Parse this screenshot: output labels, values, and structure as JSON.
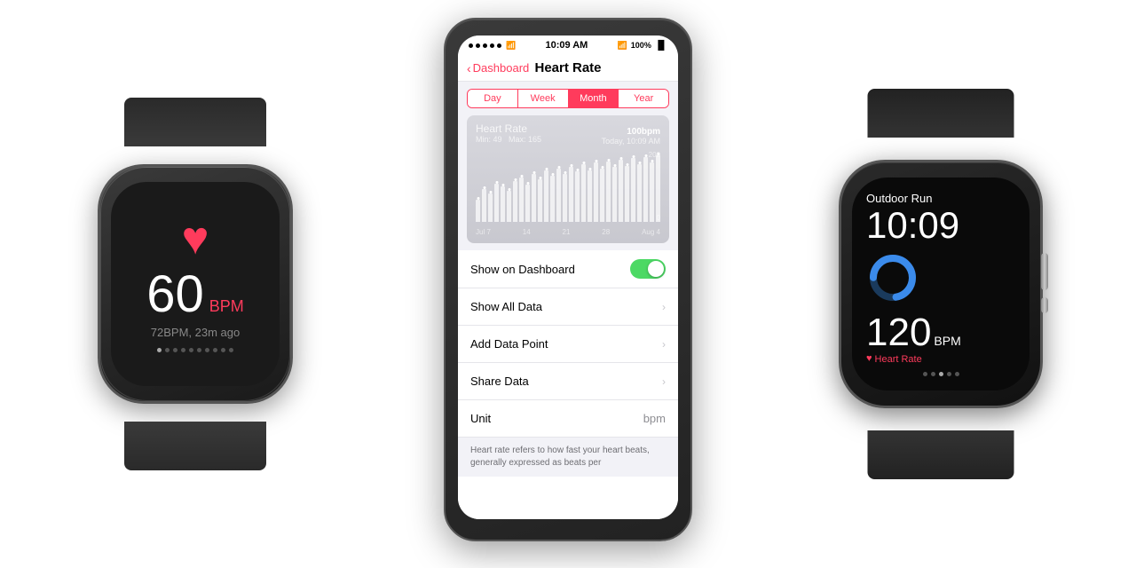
{
  "scene": {
    "background": "#ffffff"
  },
  "watch_left": {
    "heart_icon": "♥",
    "bpm_number": "60",
    "bpm_label": "BPM",
    "sub_text": "72BPM, 23m ago",
    "dots_count": 10,
    "active_dot": 0
  },
  "iphone": {
    "status_bar": {
      "dots": 5,
      "time": "10:09 AM",
      "battery": "100%"
    },
    "nav": {
      "back_label": "Dashboard",
      "title": "Heart Rate"
    },
    "period_tabs": [
      {
        "label": "Day",
        "active": false
      },
      {
        "label": "Week",
        "active": false
      },
      {
        "label": "Month",
        "active": true
      },
      {
        "label": "Year",
        "active": false
      }
    ],
    "chart": {
      "title": "Heart Rate",
      "min_label": "Min: 49",
      "max_label": "Max: 165",
      "current_bpm": "100",
      "bpm_unit": "bpm",
      "date_label": "Today, 10:09 AM",
      "y_max": "200",
      "y_min": "0",
      "x_labels": [
        "Jul 7",
        "14",
        "21",
        "28",
        "Aug 4"
      ],
      "bars": [
        30,
        45,
        38,
        52,
        48,
        42,
        55,
        60,
        50,
        65,
        58,
        70,
        62,
        72,
        65,
        75,
        68,
        78,
        70,
        80,
        72,
        82,
        74,
        84,
        76,
        86,
        78,
        88,
        80,
        90
      ]
    },
    "list_items": [
      {
        "label": "Show on Dashboard",
        "type": "toggle",
        "toggle_on": true
      },
      {
        "label": "Show All Data",
        "type": "chevron"
      },
      {
        "label": "Add Data Point",
        "type": "chevron"
      },
      {
        "label": "Share Data",
        "type": "chevron"
      },
      {
        "label": "Unit",
        "type": "value",
        "value": "bpm"
      }
    ],
    "description": "Heart rate refers to how fast your heart beats, generally expressed as beats per"
  },
  "watch_right": {
    "title": "Outdoor Run",
    "time": "10:09",
    "bpm_number": "120",
    "bpm_unit": "BPM",
    "heart_label": "Heart Rate",
    "heart_icon": "♥",
    "dots_count": 5,
    "active_dot": 2,
    "ring_color": "#3b8beb",
    "ring_bg": "#1a3a5c"
  }
}
